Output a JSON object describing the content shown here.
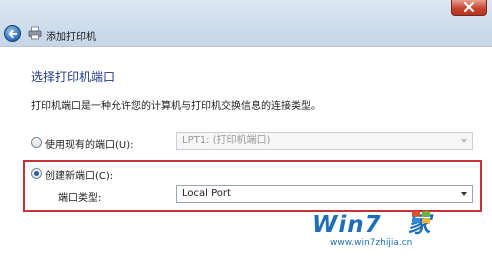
{
  "window": {
    "title": "添加打印机"
  },
  "page": {
    "heading": "选择打印机端口",
    "description": "打印机端口是一种允许您的计算机与打印机交换信息的连接类型。"
  },
  "options": {
    "existing_port": {
      "label": "使用现有的端口(U):",
      "selected": false,
      "value": "LPT1: (打印机端口)",
      "enabled": false
    },
    "new_port": {
      "label": "创建新端口(C):",
      "selected": true,
      "type_label": "端口类型:",
      "type_value": "Local Port"
    }
  },
  "watermark": {
    "brand": "Win7",
    "brand_suffix": "家",
    "url": "www.win7zhijia.cn"
  },
  "colors": {
    "heading": "#1e3a8a",
    "highlight_box": "#c4323a",
    "watermark": "#1f6fb8"
  }
}
